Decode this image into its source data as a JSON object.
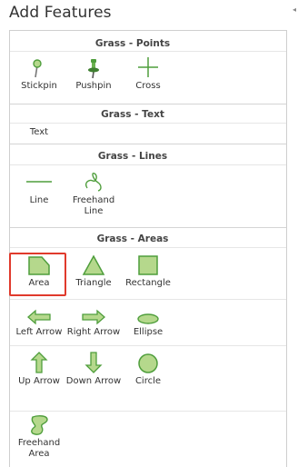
{
  "title": "Add Features",
  "sections": [
    {
      "header": "Grass - Points",
      "tools": [
        {
          "label": "Stickpin",
          "icon": "stickpin-icon"
        },
        {
          "label": "Pushpin",
          "icon": "pushpin-icon"
        },
        {
          "label": "Cross",
          "icon": "cross-icon"
        }
      ]
    },
    {
      "header": "Grass - Text",
      "tools": [
        {
          "label": "Text",
          "icon": "text-icon"
        }
      ]
    },
    {
      "header": "Grass - Lines",
      "tools": [
        {
          "label": "Line",
          "icon": "line-icon"
        },
        {
          "label": "Freehand Line",
          "icon": "freehand-line-icon"
        }
      ]
    },
    {
      "header": "Grass - Areas",
      "tools": [
        {
          "label": "Area",
          "icon": "area-icon",
          "selected": true
        },
        {
          "label": "Triangle",
          "icon": "triangle-icon"
        },
        {
          "label": "Rectangle",
          "icon": "rectangle-icon"
        },
        {
          "label": "Left Arrow",
          "icon": "left-arrow-icon"
        },
        {
          "label": "Right Arrow",
          "icon": "right-arrow-icon"
        },
        {
          "label": "Ellipse",
          "icon": "ellipse-icon"
        },
        {
          "label": "Up Arrow",
          "icon": "up-arrow-icon"
        },
        {
          "label": "Down Arrow",
          "icon": "down-arrow-icon"
        },
        {
          "label": "Circle",
          "icon": "circle-icon"
        },
        {
          "label": "Freehand Area",
          "icon": "freehand-area-icon"
        }
      ]
    }
  ],
  "colors": {
    "icon_fill": "#b5d88c",
    "icon_stroke": "#4f9e3c",
    "selection": "#e03a2c"
  }
}
